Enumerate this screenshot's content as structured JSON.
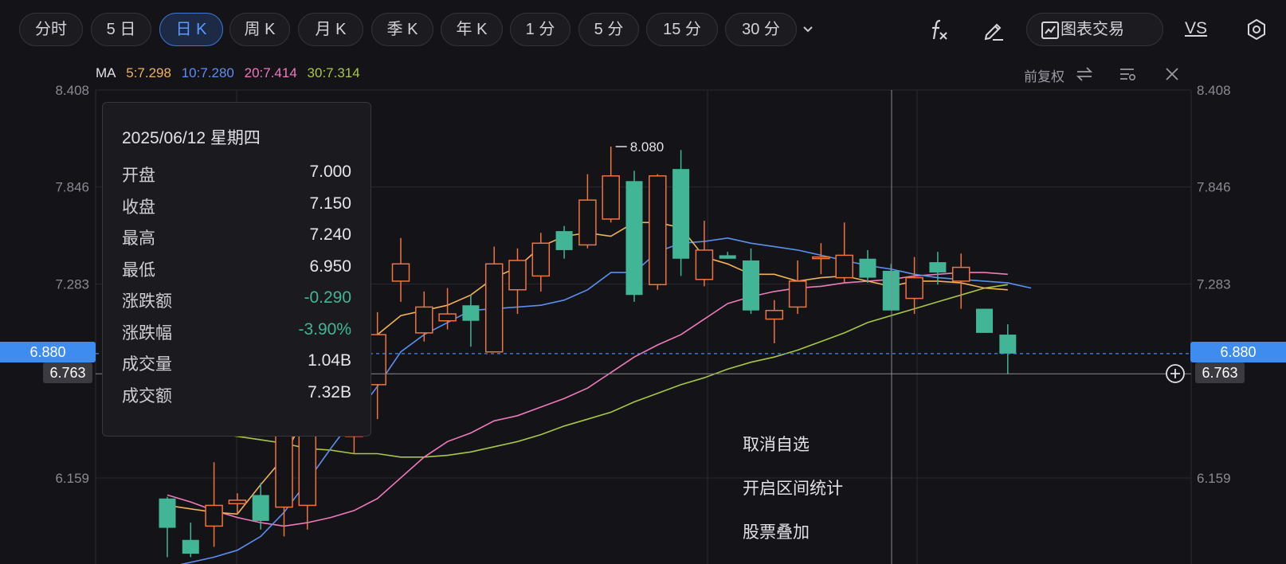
{
  "toolbar": {
    "periods": [
      "分时",
      "5 日",
      "日 K",
      "周 K",
      "月 K",
      "季 K",
      "年 K",
      "1 分",
      "5 分",
      "15 分",
      "30 分"
    ],
    "active_period": "日 K",
    "more_icon": "chevron-down-icon",
    "formula_icon": "fx-icon",
    "draw_icon": "pencil-icon",
    "chart_trade_label": "图表交易",
    "chart_trade_icon": "chart-trade-icon",
    "vs_label": "VS",
    "settings_icon": "hexagon-settings-icon"
  },
  "ma_legend": {
    "label": "MA",
    "items": [
      {
        "text": "5:7.298",
        "color": "#f0b35a"
      },
      {
        "text": "10:7.280",
        "color": "#5b8ff0"
      },
      {
        "text": "20:7.414",
        "color": "#ee7bbd"
      },
      {
        "text": "30:7.314",
        "color": "#a8c64a"
      }
    ]
  },
  "chart_controls": {
    "adjust_label": "前复权",
    "swap_icon": "swap-arrows-icon",
    "indicator_icon": "indicator-settings-icon",
    "close_icon": "close-icon"
  },
  "chart_data": {
    "type": "candlestick",
    "y_ticks_left": [
      "8.408",
      "7.846",
      "7.283",
      "6.159"
    ],
    "y_ticks_right": [
      "8.408",
      "7.846",
      "7.283",
      "6.159"
    ],
    "ylim": [
      5.7,
      8.408
    ],
    "current_price": "6.880",
    "crosshair_price": "6.763",
    "high_marker": "8.080",
    "up_color": "#ef7440",
    "down_color": "#41b596",
    "candles": [
      {
        "o": 6.04,
        "c": 5.87,
        "h": 6.05,
        "l": 5.7
      },
      {
        "o": 5.8,
        "c": 5.72,
        "h": 5.9,
        "l": 5.7
      },
      {
        "o": 5.88,
        "c": 6.0,
        "h": 6.25,
        "l": 5.76
      },
      {
        "o": 6.01,
        "c": 6.03,
        "h": 6.07,
        "l": 5.95
      },
      {
        "o": 6.06,
        "c": 5.91,
        "h": 6.13,
        "l": 5.86
      },
      {
        "o": 5.99,
        "c": 6.62,
        "h": 6.65,
        "l": 5.82
      },
      {
        "o": 6.0,
        "c": 6.76,
        "h": 6.78,
        "l": 5.86
      },
      {
        "o": 6.9,
        "c": 6.94,
        "h": 6.96,
        "l": 6.88
      },
      {
        "o": 6.4,
        "c": 6.74,
        "h": 6.76,
        "l": 6.3
      },
      {
        "o": 6.7,
        "c": 6.99,
        "h": 7.12,
        "l": 6.5
      },
      {
        "o": 7.3,
        "c": 7.4,
        "h": 7.55,
        "l": 7.18
      },
      {
        "o": 7.0,
        "c": 7.15,
        "h": 7.24,
        "l": 6.95
      },
      {
        "o": 7.07,
        "c": 7.11,
        "h": 7.26,
        "l": 7.02
      },
      {
        "o": 7.16,
        "c": 7.07,
        "h": 7.22,
        "l": 6.92
      },
      {
        "o": 6.89,
        "c": 7.4,
        "h": 7.5,
        "l": 6.89
      },
      {
        "o": 7.25,
        "c": 7.42,
        "h": 7.49,
        "l": 7.11
      },
      {
        "o": 7.33,
        "c": 7.52,
        "h": 7.58,
        "l": 7.24
      },
      {
        "o": 7.59,
        "c": 7.48,
        "h": 7.62,
        "l": 7.43
      },
      {
        "o": 7.51,
        "c": 7.77,
        "h": 7.92,
        "l": 7.49
      },
      {
        "o": 7.66,
        "c": 7.91,
        "h": 8.08,
        "l": 7.64
      },
      {
        "o": 7.88,
        "c": 7.22,
        "h": 7.94,
        "l": 7.18
      },
      {
        "o": 7.28,
        "c": 7.91,
        "h": 7.92,
        "l": 7.25
      },
      {
        "o": 7.95,
        "c": 7.43,
        "h": 8.06,
        "l": 7.33
      },
      {
        "o": 7.31,
        "c": 7.48,
        "h": 7.65,
        "l": 7.27
      },
      {
        "o": 7.45,
        "c": 7.43,
        "h": 7.47,
        "l": 7.43
      },
      {
        "o": 7.42,
        "c": 7.13,
        "h": 7.49,
        "l": 7.11
      },
      {
        "o": 7.08,
        "c": 7.13,
        "h": 7.19,
        "l": 6.94
      },
      {
        "o": 7.15,
        "c": 7.3,
        "h": 7.42,
        "l": 7.11
      },
      {
        "o": 7.44,
        "c": 7.44,
        "h": 7.52,
        "l": 7.34
      },
      {
        "o": 7.32,
        "c": 7.45,
        "h": 7.64,
        "l": 7.29
      },
      {
        "o": 7.43,
        "c": 7.32,
        "h": 7.48,
        "l": 7.29
      },
      {
        "o": 7.36,
        "c": 7.13,
        "h": 7.4,
        "l": 7.13
      },
      {
        "o": 7.2,
        "c": 7.32,
        "h": 7.44,
        "l": 7.11
      },
      {
        "o": 7.41,
        "c": 7.35,
        "h": 7.47,
        "l": 7.28
      },
      {
        "o": 7.3,
        "c": 7.38,
        "h": 7.46,
        "l": 7.14
      },
      {
        "o": 7.14,
        "c": 7.0,
        "h": 7.14,
        "l": 7.0
      },
      {
        "o": 6.99,
        "c": 6.88,
        "h": 7.05,
        "l": 6.76
      }
    ],
    "ma5": [
      6.0,
      5.98,
      5.96,
      5.95,
      6.12,
      6.28,
      6.55,
      6.69,
      6.86,
      6.99,
      7.1,
      7.13,
      7.16,
      7.22,
      7.32,
      7.38,
      7.5,
      7.56,
      7.58,
      7.56,
      7.64,
      7.64,
      7.61,
      7.44,
      7.4,
      7.34,
      7.34,
      7.3,
      7.32,
      7.33,
      7.3,
      7.27,
      7.3,
      7.3,
      7.29,
      7.26,
      7.25
    ],
    "ma10": [
      5.64,
      5.67,
      5.7,
      5.74,
      5.82,
      5.96,
      6.14,
      6.33,
      6.51,
      6.69,
      6.89,
      6.99,
      7.06,
      7.13,
      7.14,
      7.15,
      7.16,
      7.19,
      7.25,
      7.35,
      7.35,
      7.47,
      7.52,
      7.53,
      7.55,
      7.52,
      7.5,
      7.48,
      7.45,
      7.42,
      7.39,
      7.37,
      7.34,
      7.32,
      7.31,
      7.3,
      7.29,
      7.26
    ],
    "ma20": [
      6.06,
      6.02,
      5.97,
      5.93,
      5.9,
      5.88,
      5.9,
      5.93,
      5.97,
      6.04,
      6.16,
      6.28,
      6.37,
      6.42,
      6.49,
      6.52,
      6.57,
      6.62,
      6.68,
      6.77,
      6.86,
      6.93,
      6.99,
      7.08,
      7.17,
      7.21,
      7.24,
      7.26,
      7.27,
      7.29,
      7.3,
      7.31,
      7.33,
      7.34,
      7.35,
      7.35,
      7.34
    ],
    "ma30": [
      6.46,
      6.44,
      6.42,
      6.4,
      6.38,
      6.36,
      6.33,
      6.32,
      6.3,
      6.3,
      6.28,
      6.28,
      6.29,
      6.31,
      6.34,
      6.37,
      6.41,
      6.46,
      6.5,
      6.54,
      6.6,
      6.65,
      6.7,
      6.74,
      6.79,
      6.83,
      6.86,
      6.9,
      6.95,
      7.0,
      7.06,
      7.1,
      7.14,
      7.18,
      7.22,
      7.26,
      7.28
    ]
  },
  "tooltip": {
    "date": "2025/06/12 星期四",
    "rows": [
      {
        "label": "开盘",
        "value": "7.000",
        "tone": ""
      },
      {
        "label": "收盘",
        "value": "7.150",
        "tone": ""
      },
      {
        "label": "最高",
        "value": "7.240",
        "tone": ""
      },
      {
        "label": "最低",
        "value": "6.950",
        "tone": ""
      },
      {
        "label": "涨跌额",
        "value": "-0.290",
        "tone": "down"
      },
      {
        "label": "涨跌幅",
        "value": "-3.90%",
        "tone": "down"
      },
      {
        "label": "成交量",
        "value": "1.04B",
        "tone": ""
      },
      {
        "label": "成交额",
        "value": "7.32B",
        "tone": ""
      }
    ]
  },
  "context_menu": {
    "items": [
      "取消自选",
      "开启区间统计",
      "股票叠加"
    ]
  },
  "crosshair": {
    "add_icon": "plus-circle-icon"
  }
}
